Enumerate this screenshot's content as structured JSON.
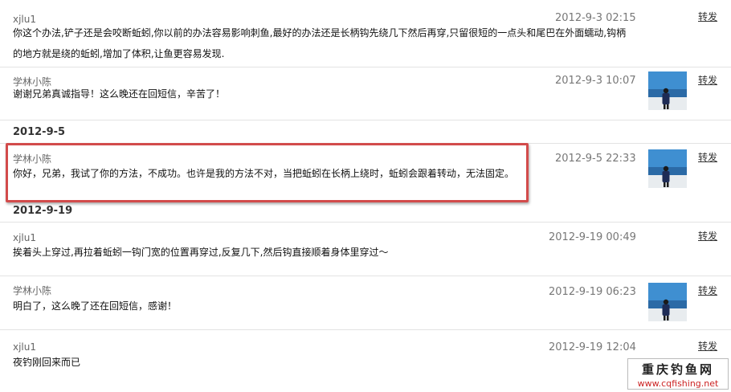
{
  "forward_label": "转发",
  "date_headers": [
    "2012-9-5",
    "2012-9-19"
  ],
  "messages": [
    {
      "author": "xjlu1",
      "time": "2012-9-3 02:15",
      "text": [
        "你这个办法,铲子还是会咬断蚯蚓,你以前的办法容易影响刺鱼,最好的办法还是长柄钩先绕几下然后再穿,只留很短的一点头和尾巴在外面蠕动,钩柄",
        "的地方就是绕的蚯蚓,增加了体积,让鱼更容易发现."
      ]
    },
    {
      "author": "学林小陈",
      "time": "2012-9-3 10:07",
      "text": [
        "谢谢兄弟真诚指导！这么晚还在回短信，辛苦了！"
      ]
    },
    {
      "author": "学林小陈",
      "time": "2012-9-5 22:33",
      "text": [
        "你好，兄弟，我试了你的方法，不成功。也许是我的方法不对，当把蚯蚓在长柄上绕时，蚯蚓会跟着转动，无法固定。"
      ]
    },
    {
      "author": "xjlu1",
      "time": "2012-9-19 00:49",
      "text": [
        "挨着头上穿过,再拉着蚯蚓一钩门宽的位置再穿过,反复几下,然后钩直接顺着身体里穿过～"
      ]
    },
    {
      "author": "学林小陈",
      "time": "2012-9-19 06:23",
      "text": [
        "明白了，这么晚了还在回短信，感谢！"
      ]
    },
    {
      "author": "xjlu1",
      "time": "2012-9-19 12:04",
      "text": [
        "夜钓刚回来而已"
      ]
    }
  ],
  "watermark": {
    "title": "重庆钓鱼网",
    "url": "www.cqfishing.net"
  },
  "colors": {
    "highlight": "#d24b4b",
    "watermark_url": "#cc2222"
  },
  "icons": {
    "avatar": "user-avatar-photo"
  }
}
